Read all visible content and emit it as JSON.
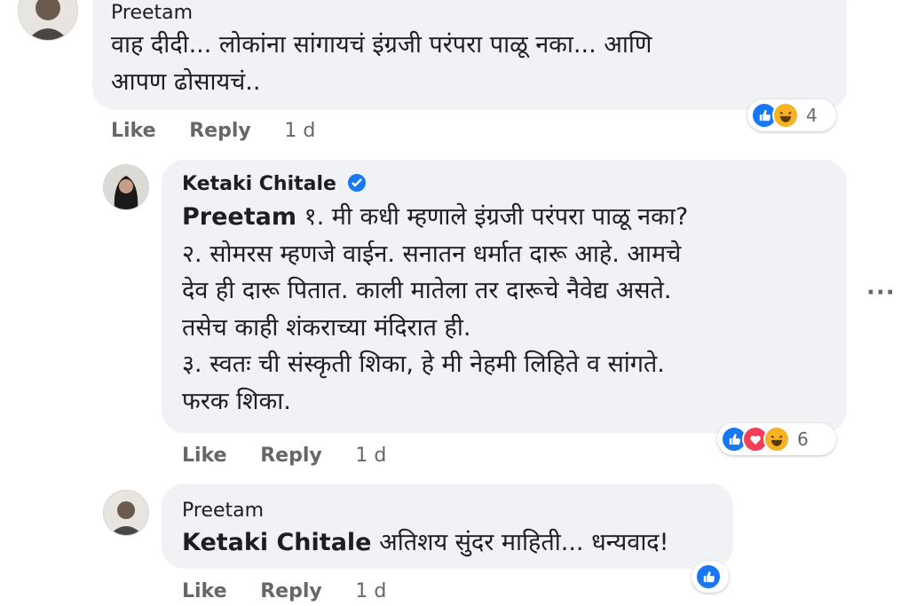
{
  "comments": [
    {
      "author": "Preetam",
      "lines": [
        "वाह दीदी... लोकांना सांगायचं इंग्रजी परंपरा पाळू नका... आणि",
        "आपण ढोसायचं.."
      ],
      "actions": {
        "like": "Like",
        "reply": "Reply",
        "time": "1 d"
      },
      "reaction_count": "4",
      "reactions": [
        "like-icon",
        "haha-icon"
      ]
    },
    {
      "author": "Ketaki Chitale",
      "verified": true,
      "mention": "Preetam",
      "lines": [
        " १. मी कधी म्हणाले इंग्रजी परंपरा पाळू नका?",
        "२. सोमरस म्हणजे वाईन. सनातन धर्मात दारू आहे. आमचे",
        "देव ही दारू पितात. काली मातेला तर दारूचे नैवेद्य असते.",
        "तसेच काही शंकराच्या मंदिरात ही.",
        "३. स्वतः ची संस्कृती शिका, हे मी नेहमी लिहिते व सांगते.",
        "फरक शिका."
      ],
      "actions": {
        "like": "Like",
        "reply": "Reply",
        "time": "1 d"
      },
      "reaction_count": "6",
      "reactions": [
        "like-icon",
        "love-icon",
        "haha-icon"
      ]
    },
    {
      "author": "Preetam",
      "mention": "Ketaki Chitale",
      "lines": [
        " अतिशय सुंदर माहिती... धन्यवाद!"
      ],
      "actions": {
        "like": "Like",
        "reply": "Reply",
        "time": "1 d"
      },
      "reaction_count": "",
      "reactions": [
        "like-icon"
      ]
    }
  ],
  "more_options": "···",
  "colors": {
    "bubble": "#f0f2f5",
    "like_blue": "#1877f2",
    "meta_gray": "#65676b"
  }
}
